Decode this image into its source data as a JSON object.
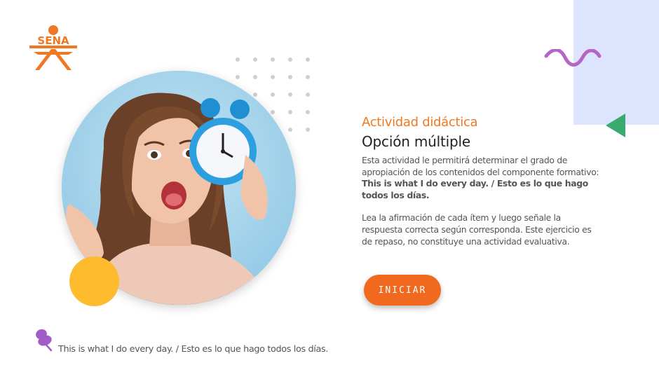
{
  "logo": {
    "text": "SENA",
    "color": "#f07822"
  },
  "heading": {
    "kicker": "Actividad didáctica",
    "title": "Opción múltiple"
  },
  "intro": {
    "text": "Esta actividad le permitirá determinar el grado de apropiación de los contenidos del componente formativo: ",
    "bold": "This is what  I do every day. /  Esto es lo que hago todos los días."
  },
  "instructions": "Lea la afirmación de cada ítem y luego señale la respuesta correcta según corresponda.  Este ejercicio es de repaso, no constituye una actividad evaluativa.",
  "start_button": {
    "label": "INICIAR"
  },
  "footer": {
    "text": "This is what  I do every day. /  Esto es lo que hago todos los días."
  },
  "colors": {
    "accent": "#f07822",
    "button": "#f0691e",
    "panel": "#dce5fd",
    "triangle": "#3aaa6f",
    "wave": "#b565c7",
    "yellow": "#fdbb2d",
    "pin": "#a15cc7"
  },
  "icons": {
    "logo": "sena-logo-icon",
    "pin": "pushpin-icon",
    "triangle": "triangle-left-icon",
    "wave": "wave-decoration-icon"
  }
}
